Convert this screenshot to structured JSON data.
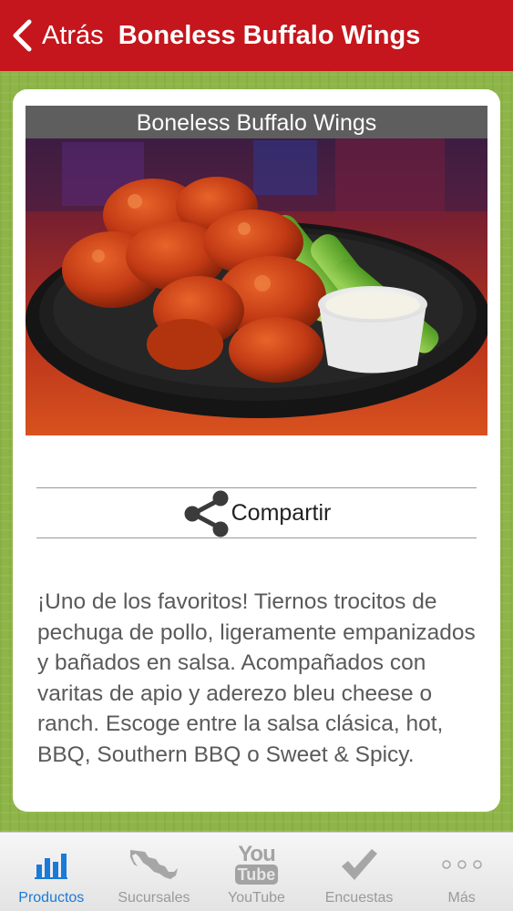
{
  "navbar": {
    "back_label": "Atrás",
    "title": "Boneless Buffalo Wings"
  },
  "product": {
    "image_caption": "Boneless Buffalo Wings",
    "share_label": "Compartir",
    "description": "¡Uno de los favoritos! Tiernos trocitos de pechuga de pollo, ligeramente empanizados y bañados en salsa. Acompañados con varitas de apio y aderezo bleu cheese o ranch. Escoge entre la salsa clásica, hot, BBQ, Southern BBQ o Sweet & Spicy."
  },
  "tabbar": {
    "tabs": [
      {
        "label": "Productos",
        "icon": "bar-chart-icon",
        "active": true
      },
      {
        "label": "Sucursales",
        "icon": "mexico-map-icon",
        "active": false
      },
      {
        "label": "YouTube",
        "icon": "youtube-icon",
        "active": false
      },
      {
        "label": "Encuestas",
        "icon": "checkmark-icon",
        "active": false
      },
      {
        "label": "Más",
        "icon": "more-dots-icon",
        "active": false
      }
    ],
    "youtube_logo_top": "You",
    "youtube_logo_bottom": "Tube"
  },
  "colors": {
    "navbar_bg": "#c4161c",
    "background_green": "#8db547",
    "active_tab": "#1a7ad8",
    "inactive_tab": "#9a9a9a"
  }
}
